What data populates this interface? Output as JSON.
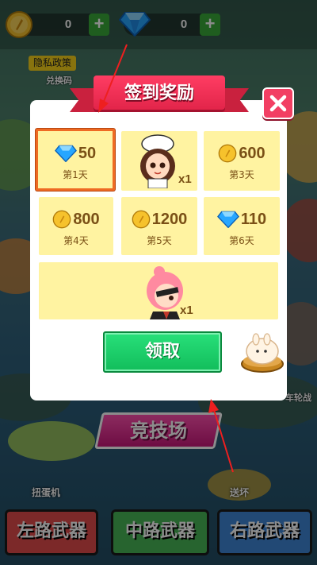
{
  "resources": {
    "gold_value": "0",
    "gems_value": "0",
    "plus_label": "+"
  },
  "background": {
    "privacy_label": "隐私政策",
    "redeem_label": "兑换码",
    "arena_label": "竞技场",
    "bottom_left_label": "扭蛋机",
    "bottom_right_label": "送坏",
    "side_right_label": "车轮战",
    "weapons": [
      "左路武器",
      "中路武器",
      "右路武器"
    ]
  },
  "dialog": {
    "title": "签到奖励",
    "claim_label": "领取",
    "rewards": [
      {
        "icon": "diamond-icon",
        "value": "50",
        "day": "第1天",
        "selected": true
      },
      {
        "icon": "character-chef-girl",
        "value": "x1",
        "day": ""
      },
      {
        "icon": "gold-coin-icon",
        "value": "600",
        "day": "第3天"
      },
      {
        "icon": "gold-coin-icon",
        "value": "800",
        "day": "第4天"
      },
      {
        "icon": "gold-coin-icon",
        "value": "1200",
        "day": "第5天"
      },
      {
        "icon": "diamond-icon",
        "value": "110",
        "day": "第6天"
      },
      {
        "icon": "character-pink-hair",
        "value": "x1",
        "day": ""
      }
    ]
  },
  "colors": {
    "accent_red": "#f23f63",
    "claim_green": "#18c765",
    "cell_yellow": "#fff3a1",
    "text_brown": "#7a5016"
  }
}
